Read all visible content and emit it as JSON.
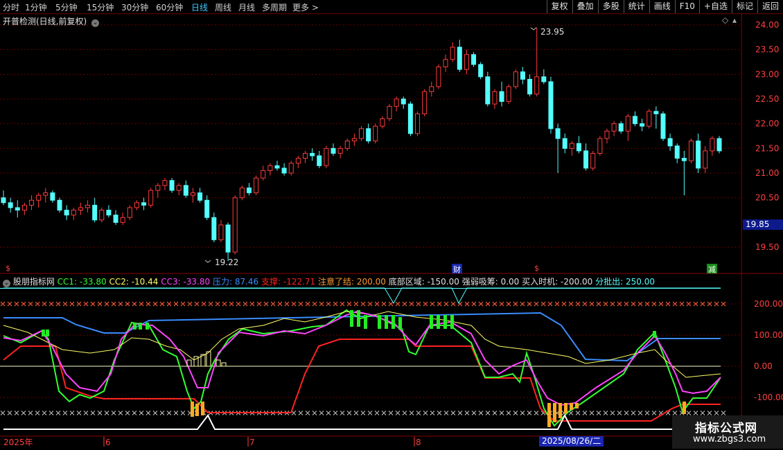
{
  "toolbar": {
    "timeframes": [
      "分时",
      "1分钟",
      "5分钟",
      "15分钟",
      "30分钟",
      "60分钟",
      "日线",
      "周线",
      "月线",
      "多周期",
      "更多 >"
    ],
    "active_timeframe": "日线",
    "right_buttons": [
      "复权",
      "叠加",
      "多股",
      "统计",
      "画线",
      "F10",
      "+自选",
      "标记",
      "返回"
    ]
  },
  "main_chart": {
    "title": "开普检测(日线,前复权)",
    "price_ticks": [
      "24.00",
      "23.50",
      "23.00",
      "22.50",
      "22.00",
      "21.50",
      "21.00",
      "20.50",
      "19.50"
    ],
    "current_price": "19.85",
    "high_label": "23.95",
    "low_label": "19.22",
    "markers": {
      "cai": "财",
      "jian": "减"
    }
  },
  "indicator": {
    "name": "股朋指标网",
    "cc1": "CC1: -33.80",
    "cc2": "CC2: -10.44",
    "cc3": "CC3: -33.80",
    "pressure": "压力: 87.46",
    "support": "支撑: -122.71",
    "attention": "注意了结: 200.00",
    "bottom_zone": "底部区域: -150.00",
    "strong_weak": "强弱吸筹: 0.00",
    "buy_time": "买入时机: -200.00",
    "sell_batch": "分批出: 250.00",
    "ticks": [
      "200.00",
      "100.00",
      "0.00",
      "-100.00"
    ]
  },
  "x_axis": {
    "labels": [
      "2025年",
      "6",
      "7",
      "8"
    ],
    "cursor_date": "2025/08/26/二"
  },
  "watermark": {
    "title": "指标公式网",
    "url": "www.zbgs3.com"
  },
  "colors": {
    "up": "#ff3c3c",
    "down": "#54ffff",
    "cc1": "#33ff33",
    "cc2": "#ffff66",
    "cc3": "#ff44ff",
    "pressure": "#3a8cff",
    "support": "#ff2222"
  },
  "chart_data": {
    "type": "candlestick",
    "y_range": [
      19.0,
      24.2
    ],
    "candles": [
      [
        20.5,
        20.65,
        20.35,
        20.4
      ],
      [
        20.4,
        20.5,
        20.2,
        20.3
      ],
      [
        20.3,
        20.45,
        20.1,
        20.25
      ],
      [
        20.25,
        20.4,
        20.15,
        20.35
      ],
      [
        20.35,
        20.55,
        20.25,
        20.45
      ],
      [
        20.45,
        20.6,
        20.3,
        20.55
      ],
      [
        20.55,
        20.7,
        20.4,
        20.6
      ],
      [
        20.6,
        20.65,
        20.4,
        20.45
      ],
      [
        20.45,
        20.5,
        20.2,
        20.25
      ],
      [
        20.25,
        20.35,
        20.05,
        20.15
      ],
      [
        20.15,
        20.3,
        20.05,
        20.25
      ],
      [
        20.25,
        20.4,
        20.15,
        20.3
      ],
      [
        20.3,
        20.45,
        20.2,
        20.35
      ],
      [
        20.35,
        20.5,
        20.0,
        20.05
      ],
      [
        20.05,
        20.3,
        20.0,
        20.25
      ],
      [
        20.25,
        20.35,
        20.1,
        20.15
      ],
      [
        20.15,
        20.25,
        19.95,
        20.0
      ],
      [
        20.0,
        20.2,
        19.95,
        20.1
      ],
      [
        20.1,
        20.35,
        20.05,
        20.3
      ],
      [
        20.3,
        20.45,
        20.25,
        20.4
      ],
      [
        20.4,
        20.5,
        20.25,
        20.35
      ],
      [
        20.35,
        20.7,
        20.3,
        20.65
      ],
      [
        20.65,
        20.8,
        20.5,
        20.75
      ],
      [
        20.75,
        20.9,
        20.65,
        20.85
      ],
      [
        20.85,
        20.9,
        20.6,
        20.65
      ],
      [
        20.65,
        20.8,
        20.55,
        20.75
      ],
      [
        20.75,
        20.85,
        20.5,
        20.55
      ],
      [
        20.55,
        20.7,
        20.4,
        20.6
      ],
      [
        20.6,
        20.7,
        20.4,
        20.45
      ],
      [
        20.45,
        20.55,
        20.05,
        20.1
      ],
      [
        20.1,
        20.2,
        19.6,
        19.65
      ],
      [
        19.65,
        20.05,
        19.6,
        19.95
      ],
      [
        19.95,
        20.0,
        19.22,
        19.4
      ],
      [
        19.4,
        20.55,
        19.35,
        20.5
      ],
      [
        20.5,
        20.75,
        20.45,
        20.7
      ],
      [
        20.7,
        20.8,
        20.55,
        20.6
      ],
      [
        20.6,
        20.95,
        20.55,
        20.9
      ],
      [
        20.9,
        21.15,
        20.85,
        21.05
      ],
      [
        21.05,
        21.2,
        20.95,
        21.15
      ],
      [
        21.15,
        21.25,
        21.05,
        21.1
      ],
      [
        21.1,
        21.2,
        20.95,
        21.0
      ],
      [
        21.0,
        21.25,
        20.95,
        21.2
      ],
      [
        21.2,
        21.35,
        21.1,
        21.3
      ],
      [
        21.3,
        21.45,
        21.2,
        21.4
      ],
      [
        21.4,
        21.5,
        21.25,
        21.35
      ],
      [
        21.35,
        21.45,
        21.1,
        21.15
      ],
      [
        21.15,
        21.55,
        21.1,
        21.5
      ],
      [
        21.5,
        21.6,
        21.35,
        21.4
      ],
      [
        21.4,
        21.55,
        21.3,
        21.5
      ],
      [
        21.5,
        21.7,
        21.45,
        21.65
      ],
      [
        21.65,
        21.8,
        21.55,
        21.7
      ],
      [
        21.7,
        21.95,
        21.65,
        21.9
      ],
      [
        21.9,
        22.0,
        21.6,
        21.65
      ],
      [
        21.65,
        22.0,
        21.6,
        21.95
      ],
      [
        21.95,
        22.15,
        21.9,
        22.1
      ],
      [
        22.1,
        22.4,
        22.05,
        22.35
      ],
      [
        22.35,
        22.55,
        22.25,
        22.5
      ],
      [
        22.5,
        22.55,
        22.3,
        22.4
      ],
      [
        22.4,
        22.45,
        21.75,
        21.8
      ],
      [
        21.8,
        22.25,
        21.75,
        22.2
      ],
      [
        22.2,
        22.7,
        22.15,
        22.65
      ],
      [
        22.65,
        22.85,
        22.55,
        22.75
      ],
      [
        22.75,
        23.2,
        22.7,
        23.15
      ],
      [
        23.15,
        23.4,
        23.05,
        23.3
      ],
      [
        23.3,
        23.65,
        23.25,
        23.55
      ],
      [
        23.55,
        23.7,
        23.05,
        23.1
      ],
      [
        23.1,
        23.5,
        23.0,
        23.4
      ],
      [
        23.4,
        23.45,
        23.15,
        23.2
      ],
      [
        23.2,
        23.25,
        22.9,
        22.95
      ],
      [
        22.95,
        23.05,
        22.35,
        22.4
      ],
      [
        22.4,
        22.7,
        22.3,
        22.65
      ],
      [
        22.65,
        22.85,
        22.35,
        22.45
      ],
      [
        22.45,
        22.8,
        22.4,
        22.75
      ],
      [
        22.75,
        23.1,
        22.7,
        23.05
      ],
      [
        23.05,
        23.15,
        22.8,
        22.9
      ],
      [
        22.9,
        23.0,
        22.55,
        22.6
      ],
      [
        22.6,
        23.95,
        22.55,
        22.95
      ],
      [
        22.95,
        23.1,
        22.8,
        22.85
      ],
      [
        22.85,
        22.95,
        21.8,
        21.9
      ],
      [
        21.9,
        22.0,
        21.0,
        21.7
      ],
      [
        21.7,
        21.8,
        21.4,
        21.5
      ],
      [
        21.5,
        21.65,
        21.35,
        21.6
      ],
      [
        21.6,
        21.75,
        21.4,
        21.45
      ],
      [
        21.45,
        21.6,
        21.05,
        21.1
      ],
      [
        21.1,
        21.45,
        21.05,
        21.4
      ],
      [
        21.4,
        21.75,
        21.35,
        21.7
      ],
      [
        21.7,
        21.9,
        21.6,
        21.85
      ],
      [
        21.85,
        22.05,
        21.75,
        22.0
      ],
      [
        22.0,
        22.05,
        21.8,
        21.85
      ],
      [
        21.85,
        22.2,
        21.65,
        22.15
      ],
      [
        22.15,
        22.25,
        21.95,
        22.0
      ],
      [
        22.0,
        22.1,
        21.85,
        21.95
      ],
      [
        21.95,
        22.3,
        21.9,
        22.25
      ],
      [
        22.25,
        22.35,
        21.9,
        22.2
      ],
      [
        22.2,
        22.25,
        21.65,
        21.7
      ],
      [
        21.7,
        21.8,
        21.45,
        21.55
      ],
      [
        21.55,
        21.6,
        21.2,
        21.3
      ],
      [
        21.3,
        21.45,
        20.55,
        21.25
      ],
      [
        21.25,
        21.7,
        21.2,
        21.65
      ],
      [
        21.65,
        21.8,
        21.0,
        21.1
      ],
      [
        21.1,
        21.55,
        21.0,
        21.45
      ],
      [
        21.45,
        21.75,
        21.35,
        21.7
      ],
      [
        21.7,
        21.75,
        21.4,
        21.45
      ]
    ]
  }
}
